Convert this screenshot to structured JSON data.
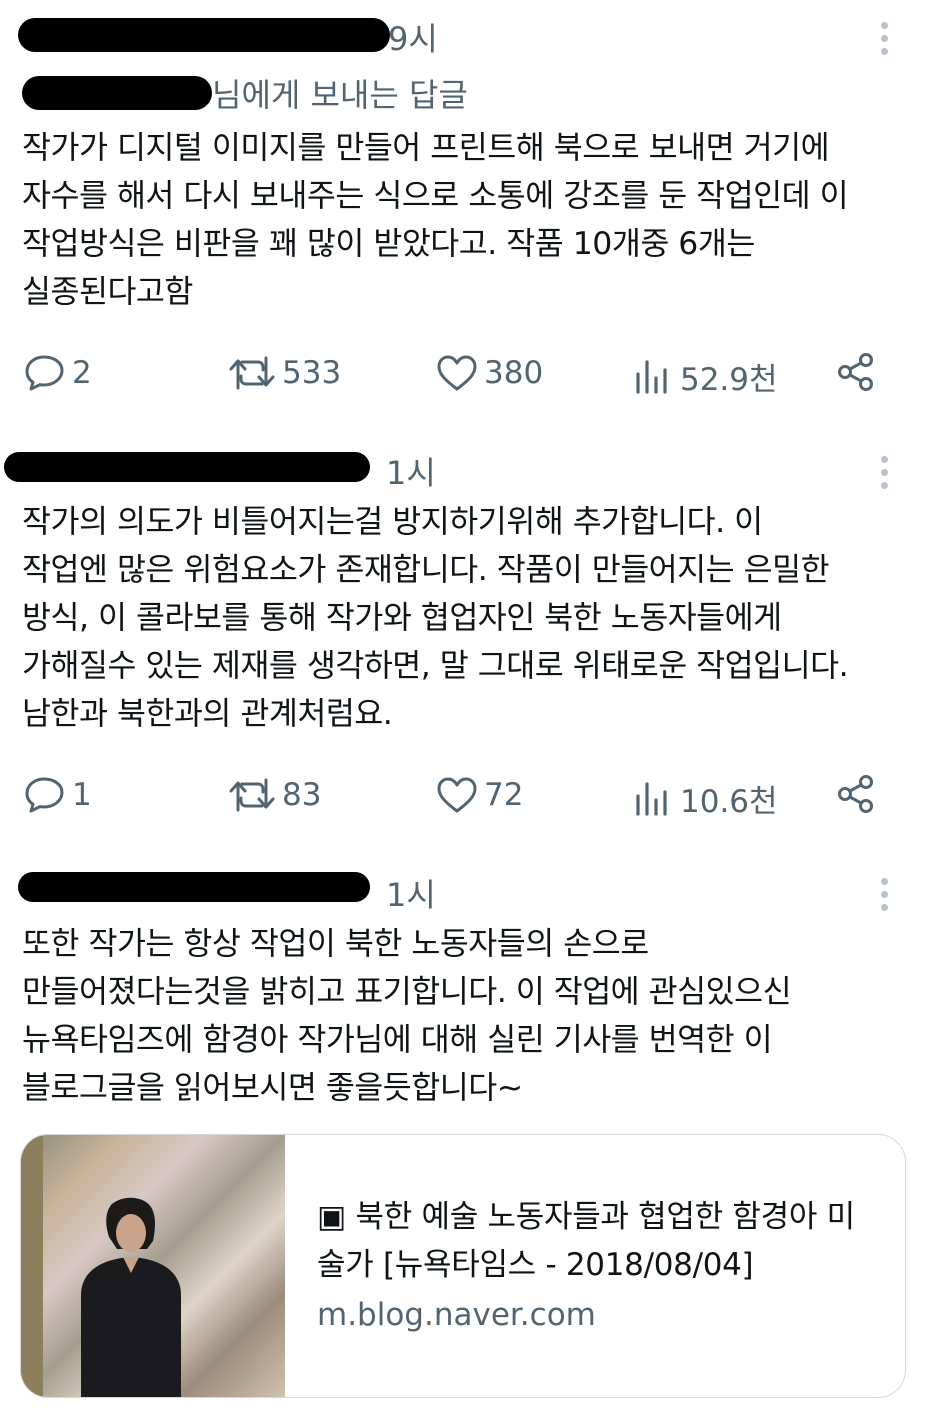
{
  "replies": [
    {
      "time": "9시",
      "reply_to": "님에게 보내는 답글",
      "text": "작가가 디지털 이미지를 만들어 프린트해 북으로 보내면 거기에\n자수를 해서 다시 보내주는 식으로 소통에 강조를 둔 작업인데 이\n작업방식은 비판을 꽤 많이 받았다고. 작품 10개중 6개는\n실종된다고함",
      "stats": {
        "replies": "2",
        "retweets": "533",
        "likes": "380",
        "views": "52.9천"
      }
    },
    {
      "time": "1시",
      "text": "작가의 의도가 비틀어지는걸 방지하기위해 추가합니다. 이\n작업엔 많은 위험요소가 존재합니다. 작품이 만들어지는 은밀한\n방식, 이 콜라보를 통해 작가와 협업자인 북한 노동자들에게\n가해질수 있는 제재를 생각하면, 말 그대로 위태로운 작업입니다.\n남한과 북한과의 관계처럼요.",
      "stats": {
        "replies": "1",
        "retweets": "83",
        "likes": "72",
        "views": "10.6천"
      }
    },
    {
      "time": "1시",
      "text": "또한 작가는 항상 작업이 북한 노동자들의 손으로\n만들어졌다는것을 밝히고 표기합니다. 이 작업에 관심있으신\n뉴욕타임즈에 함경아 작가님에 대해 실린 기사를 번역한 이\n블로그글을 읽어보시면 좋을듯합니다~"
    }
  ],
  "link_card": {
    "title": "▣ 북한 예술 노동자들과 협업한 함경아 미술가 [뉴욕타임스 - 2018/08/04]",
    "domain": "m.blog.naver.com"
  },
  "colors": {
    "text": "#0f1419",
    "secondary": "#536471",
    "border": "#cfd9de"
  },
  "icons": [
    "reply-icon",
    "retweet-icon",
    "like-icon",
    "views-icon",
    "share-icon",
    "more-icon"
  ]
}
